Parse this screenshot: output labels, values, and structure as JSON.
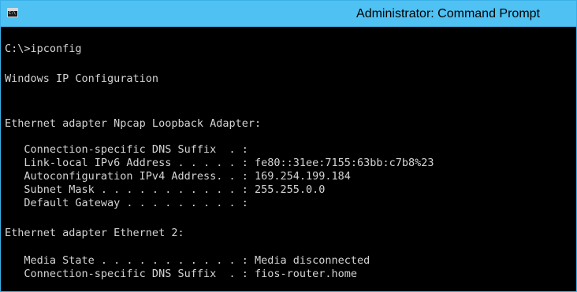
{
  "window": {
    "title": "Administrator: Command Prompt",
    "icon": "cmd-icon"
  },
  "console": {
    "lines": [
      "C:\\>ipconfig",
      "Windows IP Configuration",
      "Ethernet adapter Npcap Loopback Adapter:",
      "   Connection-specific DNS Suffix  . :",
      "   Link-local IPv6 Address . . . . . : fe80::31ee:7155:63bb:c7b8%23",
      "   Autoconfiguration IPv4 Address. . : 169.254.199.184",
      "   Subnet Mask . . . . . . . . . . . : 255.255.0.0",
      "   Default Gateway . . . . . . . . . :",
      "Ethernet adapter Ethernet 2:",
      "   Media State . . . . . . . . . . . : Media disconnected",
      "   Connection-specific DNS Suffix  . : fios-router.home"
    ]
  },
  "colors": {
    "titlebar": "#4fc1f3",
    "console_background": "#000000",
    "console_text": "#d4d4d4"
  }
}
